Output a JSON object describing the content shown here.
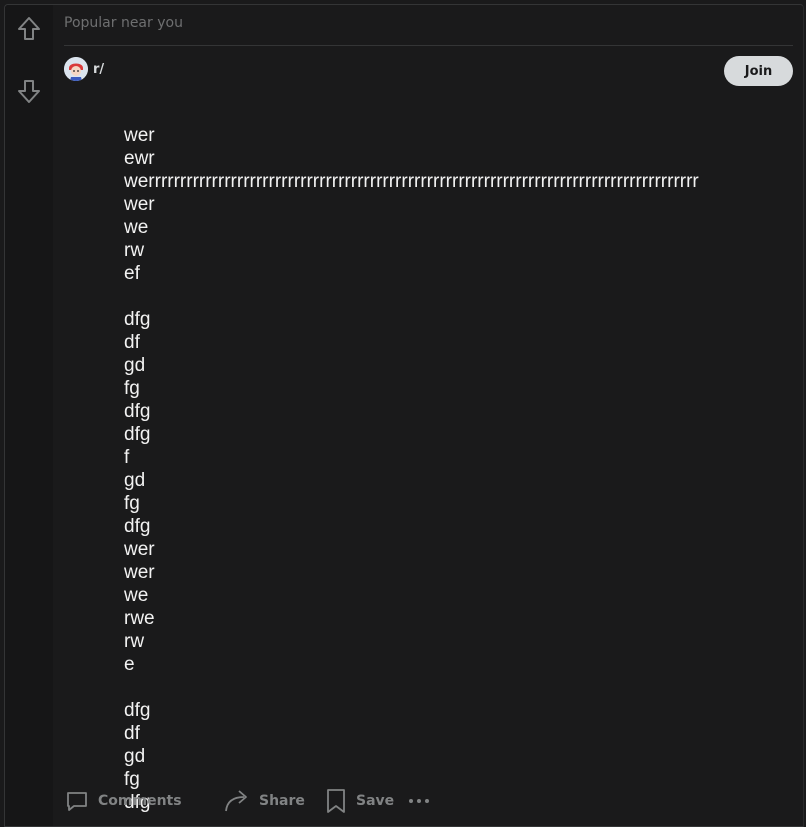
{
  "post": {
    "top_caption": "Popular near you",
    "subreddit": "r/",
    "join_label": "Join",
    "body_lines": [
      "wer",
      "ewr",
      "werrrrrrrrrrrrrrrrrrrrrrrrrrrrrrrrrrrrrrrrrrrrrrrrrrrrrrrrrrrrrrrrrrrrrrrrrrrrrrrrrrrrrrr",
      "wer",
      "we",
      "rw",
      "ef",
      "",
      "dfg",
      "df",
      "gd",
      "fg",
      "dfg",
      "dfg",
      "f",
      "gd",
      "fg",
      "dfg",
      "wer",
      "wer",
      "we",
      "rwe",
      "rw",
      "e",
      "",
      "dfg",
      "df",
      "gd",
      "fg",
      "dfg"
    ]
  },
  "actions": {
    "comments_label": "Comments",
    "share_label": "Share",
    "save_label": "Save"
  },
  "icons": {
    "upvote": "arrow-up-icon",
    "downvote": "arrow-down-icon",
    "comment": "comment-icon",
    "share": "share-icon",
    "save": "bookmark-icon",
    "more": "more-icon",
    "avatar": "subreddit-avatar"
  },
  "colors": {
    "background": "#1a1a1b",
    "vote_column": "#161617",
    "text": "#f2f2f2",
    "muted": "#818384",
    "join_button": "#d7dadc"
  }
}
